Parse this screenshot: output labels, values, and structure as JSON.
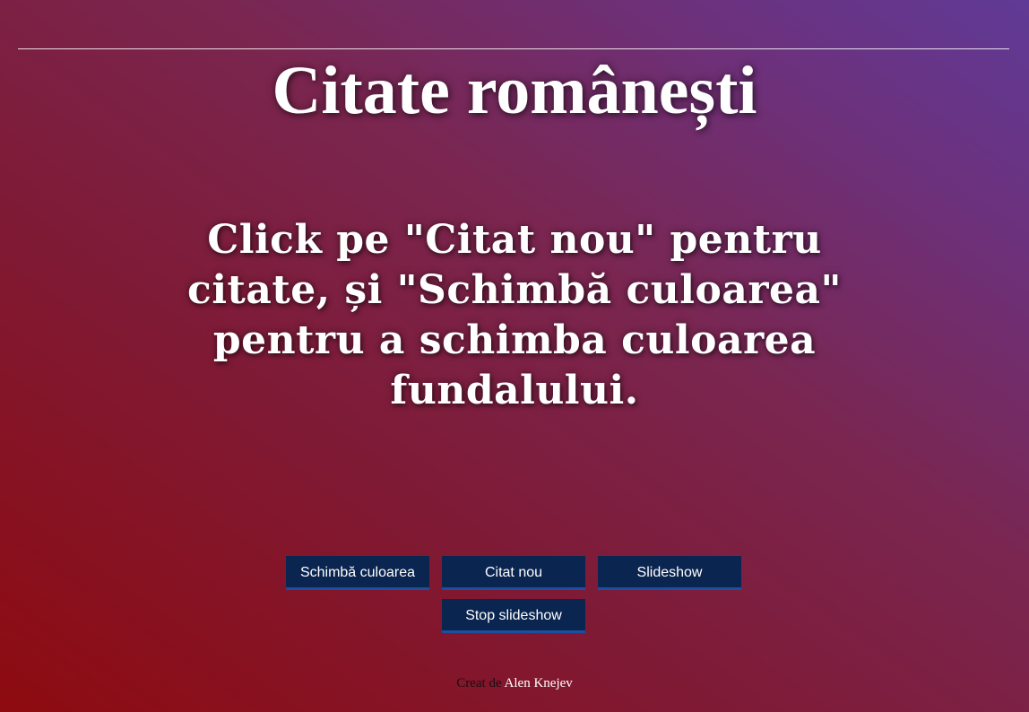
{
  "header": {
    "title": "Citate românești"
  },
  "main": {
    "quote_text": "Click pe \"Citat nou\" pentru citate, și \"Schimbă culoarea\" pentru a schimba culoarea fundalului."
  },
  "buttons": {
    "change_color": "Schimbă culoarea",
    "new_quote": "Citat nou",
    "slideshow": "Slideshow",
    "stop_slideshow": "Stop slideshow"
  },
  "footer": {
    "created_by": "Creat de",
    "author": "Alen Knejev"
  },
  "colors": {
    "button_bg": "#0a2550",
    "button_border": "#1d4fa0",
    "gradient_start": "#8e0b10",
    "gradient_end": "#5f3a96"
  }
}
